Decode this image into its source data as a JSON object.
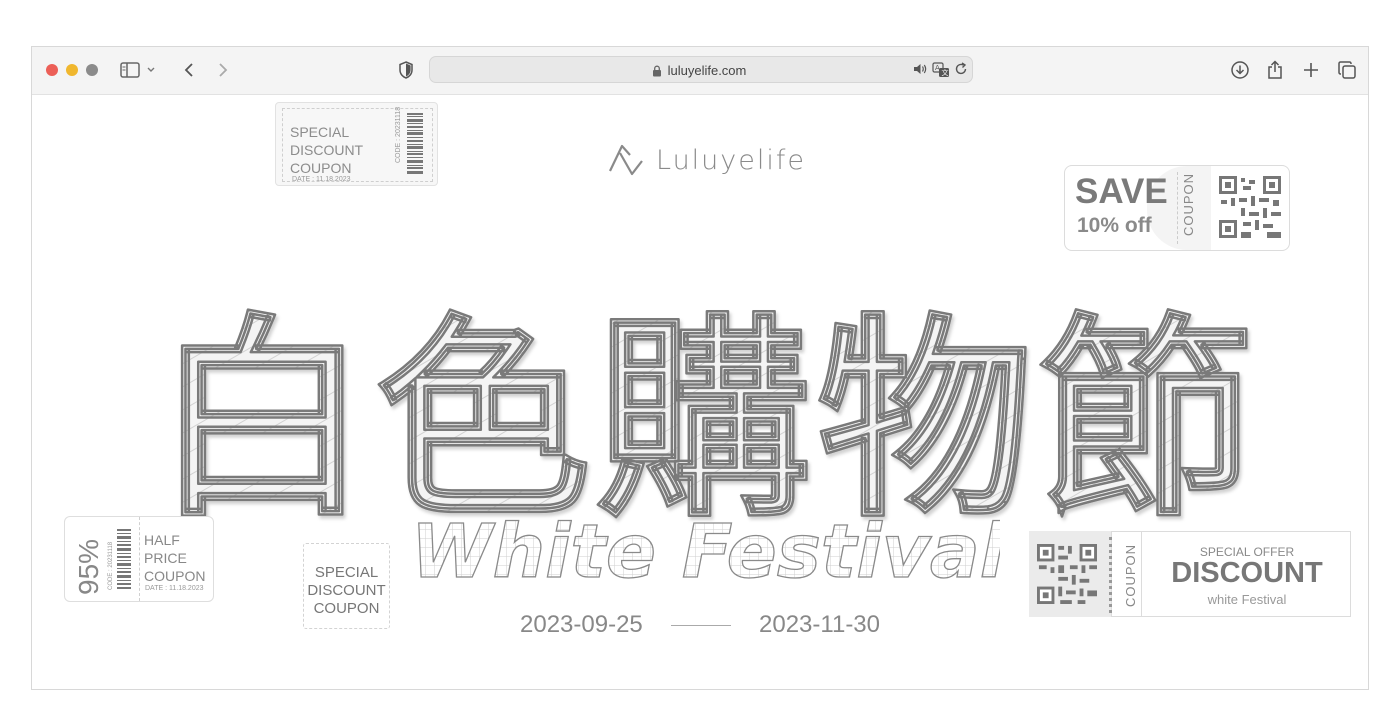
{
  "browser": {
    "url": "luluyelife.com",
    "icons": {
      "sidebar": "sidebar-icon",
      "back": "chevron-left-icon",
      "forward": "chevron-right-icon",
      "shield": "shield-icon",
      "lock": "lock-icon",
      "audio": "speaker-icon",
      "translate": "translate-icon",
      "reload": "reload-icon",
      "download": "download-icon",
      "share": "share-icon",
      "new_tab": "plus-icon",
      "tabs": "tabs-overview-icon"
    }
  },
  "page": {
    "logo_text": "Luluyelife",
    "headline": "白色購物節",
    "subtitle": "White Festival",
    "start_date": "2023-09-25",
    "end_date": "2023-11-30"
  },
  "coupons": {
    "top_left": {
      "lines": [
        "SPECIAL",
        "DISCOUNT",
        "COUPON"
      ],
      "date": "DATE : 11.18.2023",
      "code": "CODE : 20231118"
    },
    "top_right": {
      "headline": "SAVE",
      "offer": "10% off",
      "label": "COUPON"
    },
    "mid_left": {
      "percent": "95%",
      "code": "CODE : 20231118",
      "lines": [
        "HALF",
        "PRICE",
        "COUPON"
      ],
      "date": "DATE : 11.18.2023"
    },
    "mid": {
      "lines": [
        "SPECIAL",
        "DISCOUNT",
        "COUPON"
      ]
    },
    "bottom_right": {
      "label": "COUPON",
      "kicker": "SPECIAL OFFER",
      "headline": "DISCOUNT",
      "tagline": "white Festival"
    }
  },
  "colors": {
    "traffic_red": "#ec5f57",
    "traffic_yellow": "#f0b72e",
    "traffic_gray": "#8b8b8b"
  }
}
